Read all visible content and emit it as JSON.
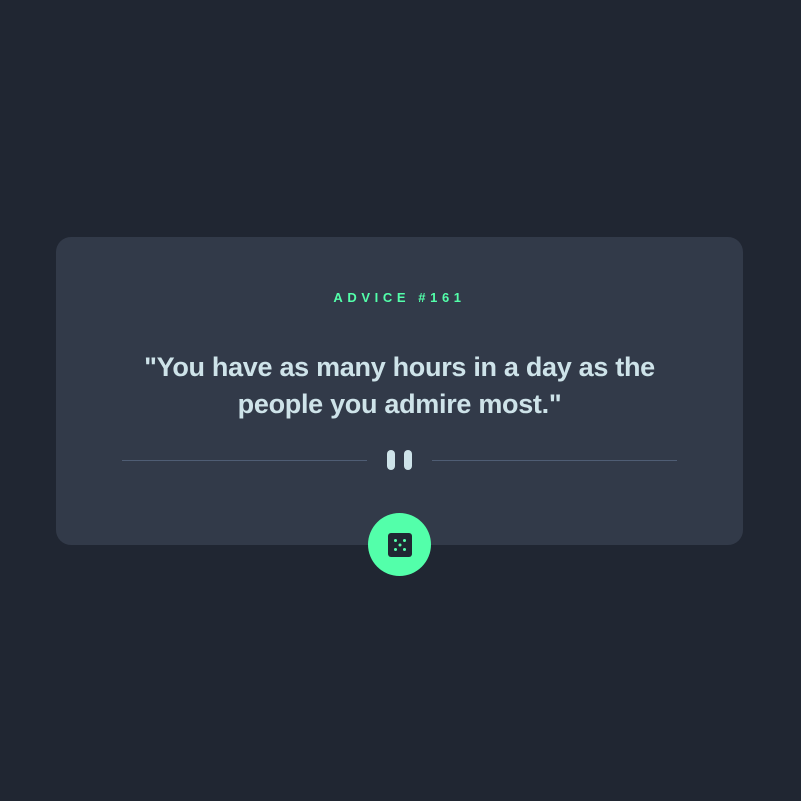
{
  "card": {
    "advice_label": "ADVICE #161",
    "quote": "\"You have as many hours in a day as the people you admire most.\""
  },
  "divider": {
    "icon": "pause-icon"
  },
  "button": {
    "icon": "dice-icon"
  },
  "colors": {
    "background": "#202632",
    "card": "#323A49",
    "accent": "#53FFAA",
    "text": "#CEE3E9",
    "divider": "#4F5D74"
  }
}
